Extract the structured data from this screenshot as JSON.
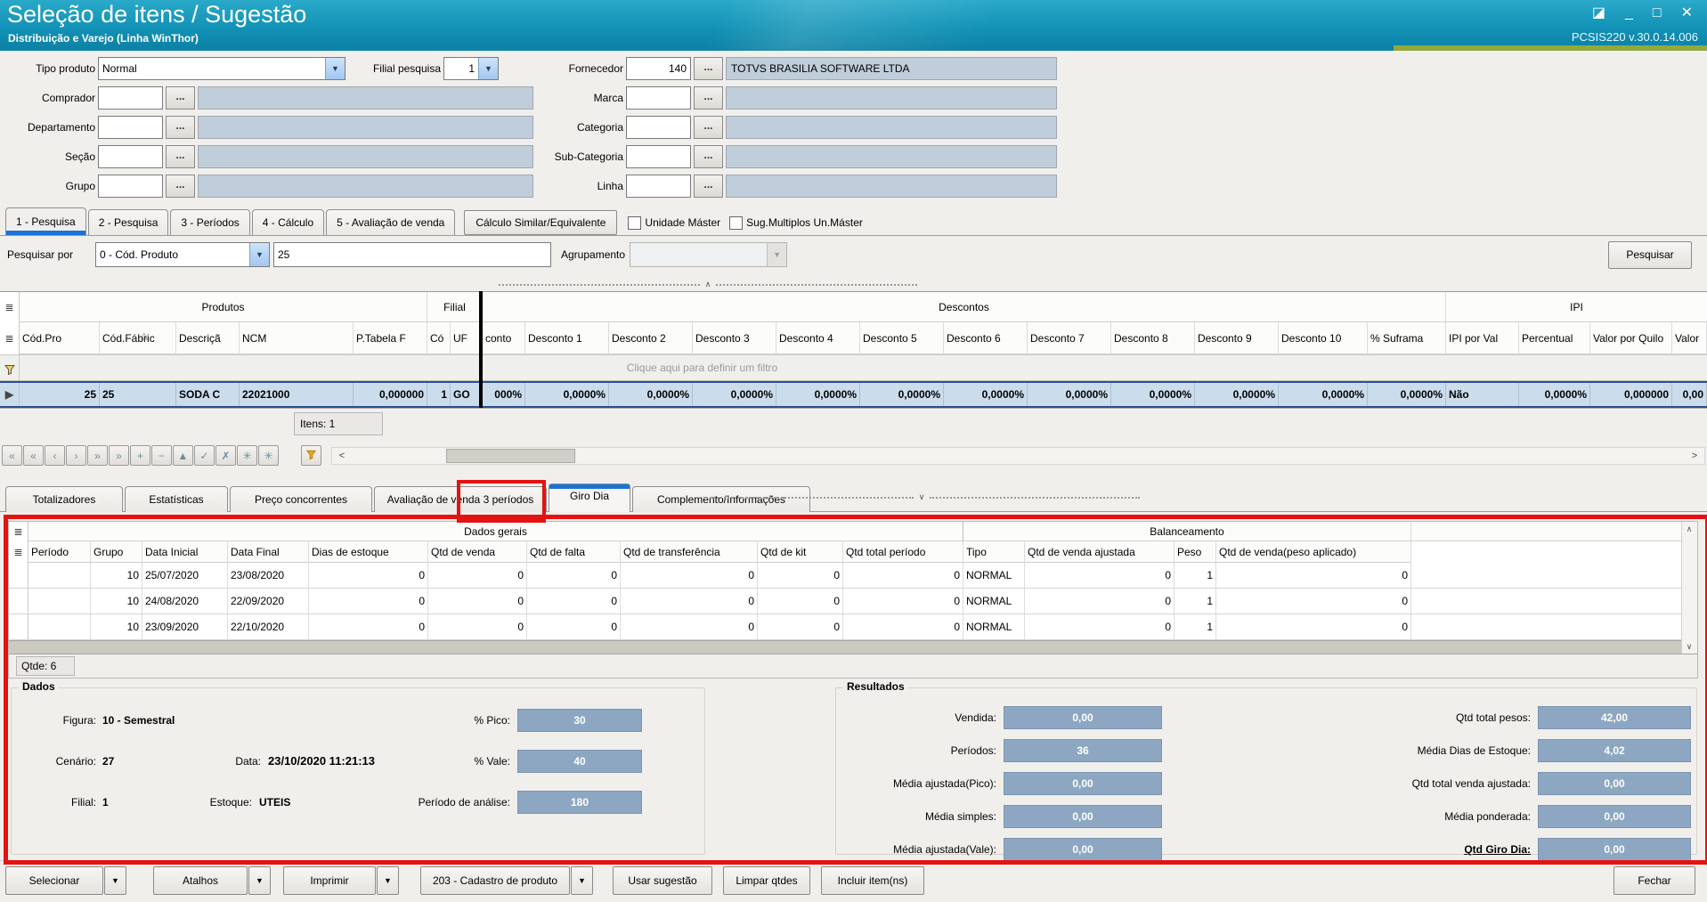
{
  "titlebar": {
    "title": "Seleção de itens / Sugestão",
    "subtitle": "Distribuição e Varejo (Linha WinThor)",
    "version": "PCSIS220  v.30.0.14.006"
  },
  "icons": {
    "restore": "◪",
    "minimize": "_",
    "maximize": "□",
    "close": "✕",
    "dropdown": "▼",
    "lookup": "...",
    "sort": "△",
    "row_marker": "▶",
    "grid_menu": "≣",
    "up": "∧",
    "down": "∨",
    "left": "<",
    "right": ">"
  },
  "colors": {
    "accent_blue": "#1b72d8",
    "annotation_red": "#e51212",
    "field_disabled": "#c0cdda",
    "value_box": "#8da7c2",
    "titlebar_teal": "#1292b6"
  },
  "filters": {
    "tipo_produto_label": "Tipo produto",
    "tipo_produto_value": "Normal",
    "filial_label": "Filial pesquisa",
    "filial_value": "1",
    "fornecedor_label": "Fornecedor",
    "fornecedor_code": "140",
    "fornecedor_name": "TOTVS BRASILIA SOFTWARE LTDA",
    "left_rows": [
      {
        "label": "Comprador"
      },
      {
        "label": "Departamento"
      },
      {
        "label": "Seção"
      },
      {
        "label": "Grupo"
      }
    ],
    "right_rows": [
      {
        "label": "Marca"
      },
      {
        "label": "Categoria"
      },
      {
        "label": "Sub-Categoria"
      },
      {
        "label": "Linha"
      }
    ]
  },
  "tabs_top": {
    "items": [
      "1 - Pesquisa",
      "2 - Pesquisa",
      "3 - Períodos",
      "4 - Cálculo",
      "5 - Avaliação de venda"
    ],
    "active": "1 - Pesquisa",
    "similar_button": "Cálculo Similar/Equivalente",
    "checkbox1": "Unidade Máster",
    "checkbox2": "Sug.Multiplos Un.Máster"
  },
  "search": {
    "label": "Pesquisar por",
    "mode": "0 - Cód. Produto",
    "value": "25",
    "group_label": "Agrupamento",
    "button": "Pesquisar"
  },
  "grid": {
    "group_produtos": "Produtos",
    "group_filial": "Filial",
    "group_descontos": "Descontos",
    "group_ipi": "IPI",
    "columns": [
      "Cód.Pro",
      "Cód.Fábric",
      "Descriçã",
      "NCM",
      "P.Tabela F",
      "Có",
      "UF",
      "conto",
      "Desconto 1",
      "Desconto 2",
      "Desconto 3",
      "Desconto 4",
      "Desconto 5",
      "Desconto 6",
      "Desconto 7",
      "Desconto 8",
      "Desconto 9",
      "Desconto 10",
      "% Suframa",
      "IPI por Val",
      "Percentual",
      "Valor por Quilo",
      "Valor"
    ],
    "filter_hint": "Clique aqui para definir um filtro",
    "row": [
      "25",
      "25",
      "SODA C",
      "22021000",
      "0,000000",
      "1",
      "GO",
      "000%",
      "0,0000%",
      "0,0000%",
      "0,0000%",
      "0,0000%",
      "0,0000%",
      "0,0000%",
      "0,0000%",
      "0,0000%",
      "0,0000%",
      "0,0000%",
      "0,0000%",
      "Não",
      "0,0000%",
      "0,000000",
      "0,00"
    ],
    "footer": "Itens: 1"
  },
  "navigator": {
    "icons": [
      "«",
      "«",
      "‹",
      "›",
      "»",
      "»",
      "+",
      "−",
      "▲",
      "✓",
      "✗",
      "✳",
      "✳"
    ]
  },
  "tabs_bottom": {
    "items": [
      "Totalizadores",
      "Estatísticas",
      "Preço concorrentes",
      "Avaliação de venda 3 períodos",
      "Giro Dia",
      "Complemento/Informações"
    ],
    "active": "Giro Dia"
  },
  "giro": {
    "group_left": "Dados gerais",
    "group_right": "Balanceamento",
    "columns": [
      "Período",
      "Grupo",
      "Data Inicial",
      "Data Final",
      "Dias de estoque",
      "Qtd de venda",
      "Qtd de falta",
      "Qtd de transferência",
      "Qtd de kit",
      "Qtd total período",
      "Tipo",
      "Qtd de venda ajustada",
      "Peso",
      "Qtd de venda(peso aplicado)"
    ],
    "rows": [
      [
        "",
        "10",
        "25/07/2020",
        "23/08/2020",
        "0",
        "0",
        "0",
        "0",
        "0",
        "0",
        "NORMAL",
        "0",
        "1",
        "0"
      ],
      [
        "",
        "10",
        "24/08/2020",
        "22/09/2020",
        "0",
        "0",
        "0",
        "0",
        "0",
        "0",
        "NORMAL",
        "0",
        "1",
        "0"
      ],
      [
        "",
        "10",
        "23/09/2020",
        "22/10/2020",
        "0",
        "0",
        "0",
        "0",
        "0",
        "0",
        "NORMAL",
        "0",
        "1",
        "0"
      ]
    ],
    "footer": "Qtde: 6"
  },
  "dados": {
    "title": "Dados",
    "figura_label": "Figura:",
    "figura": "10 - Semestral",
    "pico_label": "% Pico:",
    "pico": "30",
    "cenario_label": "Cenário:",
    "cenario": "27",
    "data_label": "Data:",
    "data": "23/10/2020 11:21:13",
    "vale_label": "% Vale:",
    "vale": "40",
    "filial_label": "Filial:",
    "filial": "1",
    "estoque_label": "Estoque:",
    "estoque": "UTEIS",
    "analise_label": "Período de análise:",
    "analise": "180"
  },
  "resultados": {
    "title": "Resultados",
    "rows_left": [
      {
        "label": "Vendida:",
        "value": "0,00"
      },
      {
        "label": "Períodos:",
        "value": "36"
      },
      {
        "label": "Média ajustada(Pico):",
        "value": "0,00"
      },
      {
        "label": "Média simples:",
        "value": "0,00"
      },
      {
        "label": "Média ajustada(Vale):",
        "value": "0,00"
      }
    ],
    "rows_right": [
      {
        "label": "Qtd total pesos:",
        "value": "42,00"
      },
      {
        "label": "Média Dias de Estoque:",
        "value": "4,02"
      },
      {
        "label": "Qtd total venda ajustada:",
        "value": "0,00"
      },
      {
        "label": "Média ponderada:",
        "value": "0,00"
      },
      {
        "label": "Qtd Giro Dia:",
        "value": "0,00"
      }
    ]
  },
  "footer": {
    "buttons": [
      "Selecionar",
      "Atalhos",
      "Imprimir",
      "203 - Cadastro de produto",
      "Usar sugestão",
      "Limpar qtdes",
      "Incluir item(ns)"
    ],
    "close": "Fechar"
  }
}
